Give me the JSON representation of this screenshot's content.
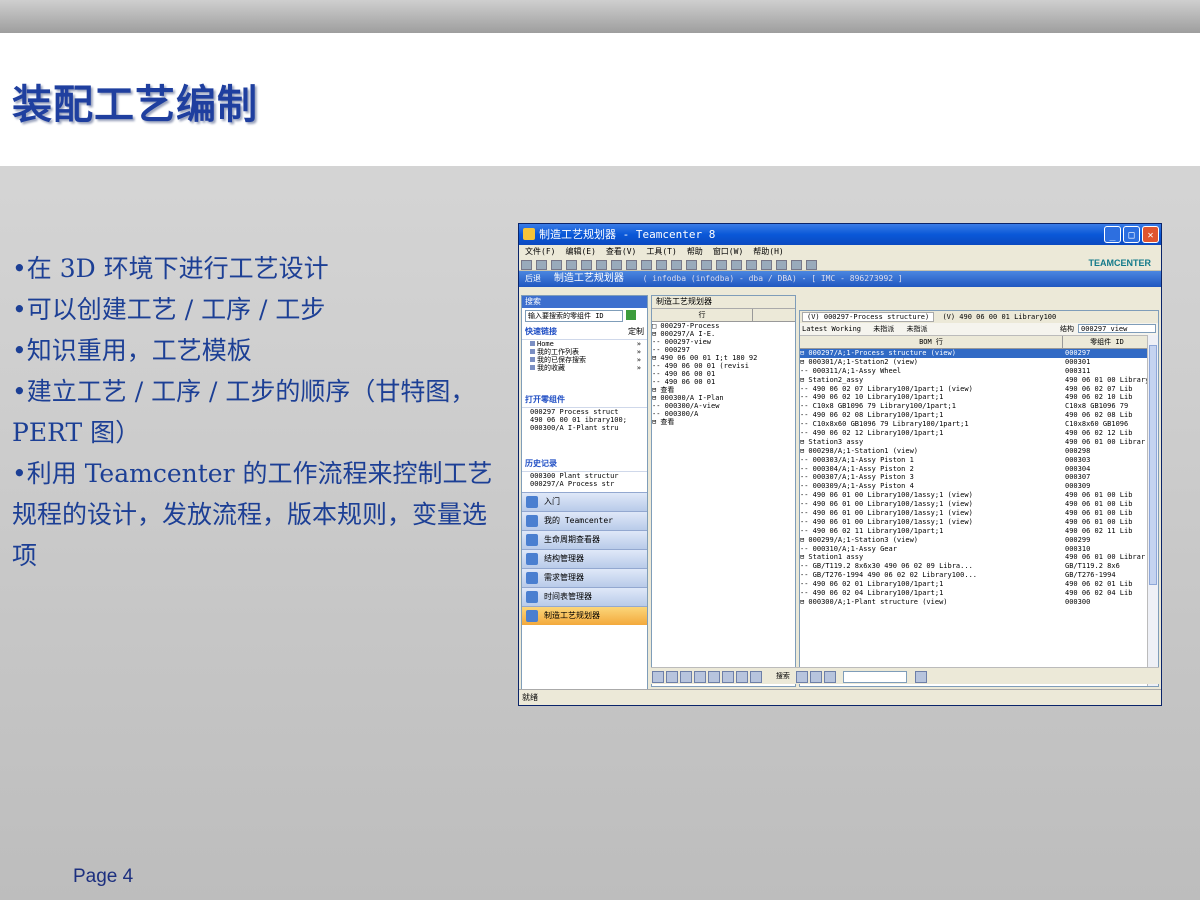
{
  "slide": {
    "title": "装配工艺编制",
    "bullets": [
      "•在 3D 环境下进行工艺设计",
      "•可以创建工艺 / 工序 / 工步",
      "•知识重用，工艺模板",
      "•建立工艺 / 工序 / 工步的顺序（甘特图， PERT 图）",
      "•利用 Teamcenter 的工作流程来控制工艺规程的设计，发放流程，版本规则，变量选项"
    ],
    "page": "Page 4"
  },
  "window": {
    "title": "制造工艺规划器 - Teamcenter 8",
    "brand": "TEAMCENTER",
    "menu": [
      "文件(F)",
      "编辑(E)",
      "查看(V)",
      "工具(T)",
      "帮助",
      "窗口(W)",
      "帮助(H)"
    ],
    "bluebar": {
      "back": "后退",
      "app_title": "制造工艺规划器",
      "context": "( infodba (infodba) - dba / DBA) - [ IMC - 896273992 ]"
    },
    "left_nav": {
      "search_title": "搜索",
      "search_placeholder": "输入要搜索的零组件 ID",
      "quick_links_title": "快速链接",
      "quick_links_extra": "定制",
      "quick_links": [
        "Home",
        "我的工作列表",
        "我的已保存搜索",
        "我的收藏"
      ],
      "open_items_title": "打开零组件",
      "open_items": [
        "000297 Process struct",
        "490 06 00 01 ibrary100;",
        "000300/A I-Plant stru"
      ],
      "history_title": "历史记录",
      "history": [
        "000300 Plant structur",
        "000297/A Process str"
      ],
      "apps": [
        "入门",
        "我的 Teamcenter",
        "生命周期查看器",
        "结构管理器",
        "需求管理器",
        "时间表管理器",
        "制造工艺规划器"
      ],
      "active_app": "制造工艺规划器"
    },
    "mid": {
      "tab": "制造工艺规划器",
      "col": "行",
      "rows": [
        "□ 000297-Process",
        "  ⊟ 000297/A I-E.",
        "    -- 000297-view",
        "    -- 000297",
        "⊟ 490 06 00 01 I;t 180 92",
        "    -- 490 06 00 01 (revisi",
        "    -- 490 06 00 01",
        "    -- 490 06 00 01",
        "  ⊟ 查看",
        "⊟ 000300/A I-Plan",
        "    -- 000300/A-view",
        "    -- 000300/A",
        "  ⊟ 查看"
      ]
    },
    "right": {
      "tabs": [
        "(V) 000297-Process structure)",
        "(V) 490 06 00 01 Library100"
      ],
      "tool_labels": [
        "Latest Working",
        "未指派",
        "未指派"
      ],
      "config_label": "结构",
      "config_value": "000297 view",
      "col1": "BOM 行",
      "col2": "零组件 ID",
      "rows": [
        {
          "a": "⊟ 000297/A;1-Process structure (view)",
          "b": "000297",
          "sel": true
        },
        {
          "a": "  ⊟ 000301/A;1-Station2 (view)",
          "b": "000301"
        },
        {
          "a": "    -- 000311/A;1-Assy Wheel",
          "b": "000311"
        },
        {
          "a": "    ⊟ Station2_assy",
          "b": "490 06 01 00 Library"
        },
        {
          "a": "      -- 490 06 02 07 Library100/1part;1 (view)",
          "b": "490 06 02 07 Lib"
        },
        {
          "a": "      -- 490 06 02 10 Library100/1part;1",
          "b": "490 06 02 10 Lib"
        },
        {
          "a": "      -- C10x8 GB1096 79 Library100/1part;1",
          "b": "C10x8 GB1096 79"
        },
        {
          "a": "      -- 490 06 02 08 Library100/1part;1",
          "b": "490 06 02 08 Lib"
        },
        {
          "a": "      -- C10x8x60 GB1096 79 Library100/1part;1",
          "b": "C10x8x60 GB1096"
        },
        {
          "a": "      -- 490 06 02 12 Library100/1part;1",
          "b": "490 06 02 12 Lib"
        },
        {
          "a": "  ⊟ Station3 assy",
          "b": "490 06 01 00 Librar"
        },
        {
          "a": "  ⊟ 000298/A;1-Station1 (view)",
          "b": "000298"
        },
        {
          "a": "    -- 000303/A;1-Assy Piston 1",
          "b": "000303"
        },
        {
          "a": "    -- 000304/A;1-Assy Piston 2",
          "b": "000304"
        },
        {
          "a": "    -- 000307/A;1-Assy Piston 3",
          "b": "000307"
        },
        {
          "a": "    -- 000309/A;1-Assy Piston 4",
          "b": "000309"
        },
        {
          "a": "    -- 490 06 01 00 Library100/1assy;1 (view)",
          "b": "490 06 01 00 Lib"
        },
        {
          "a": "    -- 490 06 01 00 Library100/1assy;1 (view)",
          "b": "490 06 01 00 Lib"
        },
        {
          "a": "    -- 490 06 01 00 Library100/1assy;1 (view)",
          "b": "490 06 01 00 Lib"
        },
        {
          "a": "    -- 490 06 01 00 Library100/1assy;1 (view)",
          "b": "490 06 01 00 Lib"
        },
        {
          "a": "    -- 490 06 02 11 Library100/1part;1",
          "b": "490 06 02 11 Lib"
        },
        {
          "a": "  ⊟ 000299/A;1-Station3 (view)",
          "b": "000299"
        },
        {
          "a": "    -- 000310/A;1-Assy Gear",
          "b": "000310"
        },
        {
          "a": "    ⊟ Station1 assy",
          "b": "490 06 01 00 Librar"
        },
        {
          "a": "      -- GB/T119.2 8x6x30 490 06 02 09 Libra...",
          "b": "GB/T119.2 8x6"
        },
        {
          "a": "      -- GB/T276-1994 490 06 02 02 Library100...",
          "b": "GB/T276-1994"
        },
        {
          "a": "      -- 490 06 02 01 Library100/1part;1",
          "b": "490 06 02 01 Lib"
        },
        {
          "a": "      -- 490 06 02 04 Library100/1part;1",
          "b": "490 06 02 04 Lib"
        },
        {
          "a": "⊟ 000300/A;1-Plant structure (view)",
          "b": "000300"
        }
      ]
    },
    "bottom": {
      "find": "搜索"
    },
    "status": "就绪"
  }
}
